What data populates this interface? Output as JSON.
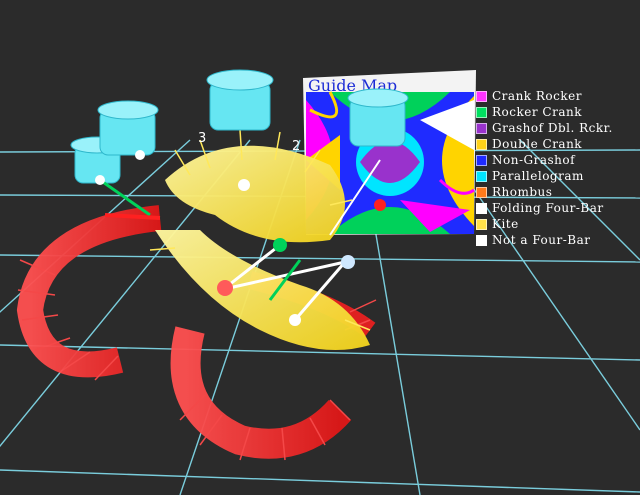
{
  "scene": {
    "background": "#2b2b2b",
    "grid_color": "#7fd6e6",
    "axis_marks": [
      "3",
      "2"
    ]
  },
  "guide_map": {
    "title": "Guide Map",
    "colors": [
      "#ff00ff",
      "#00d15a",
      "#9932cc",
      "#ffd400",
      "#1f2bff",
      "#00e5ff",
      "#ff7a1a",
      "#ffffff"
    ]
  },
  "legend": [
    {
      "label": "Crank Rocker",
      "color": "#ff33ff"
    },
    {
      "label": "Rocker Crank",
      "color": "#00e060"
    },
    {
      "label": "Grashof Dbl. Rckr.",
      "color": "#9932cc"
    },
    {
      "label": "Double Crank",
      "color": "#ffd21a"
    },
    {
      "label": "Non-Grashof",
      "color": "#1f2bff"
    },
    {
      "label": "Parallelogram",
      "color": "#00e5ff"
    },
    {
      "label": "Rhombus",
      "color": "#ff7a1a"
    },
    {
      "label": "Folding Four-Bar",
      "color": "#ffffff"
    },
    {
      "label": "Kite",
      "color": "#ffe14a"
    },
    {
      "label": "Not a Four-Bar",
      "color": "#ffffff"
    }
  ]
}
